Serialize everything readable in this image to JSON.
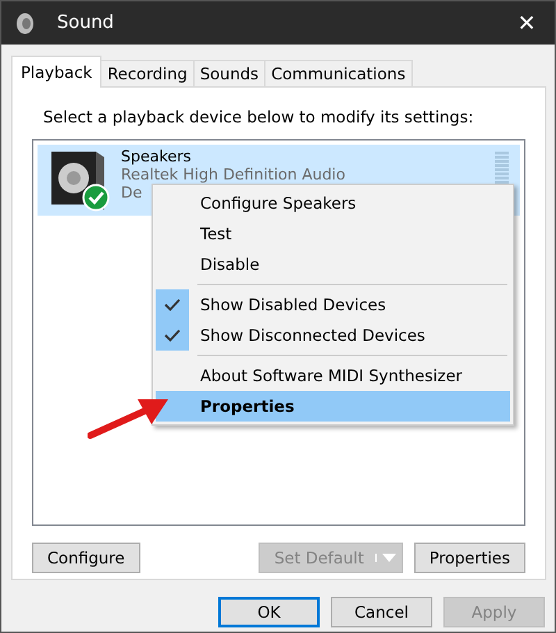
{
  "window": {
    "title": "Sound",
    "close": "✕"
  },
  "tabs": [
    {
      "label": "Playback",
      "selected": true
    },
    {
      "label": "Recording",
      "selected": false
    },
    {
      "label": "Sounds",
      "selected": false
    },
    {
      "label": "Communications",
      "selected": false
    }
  ],
  "instruction": "Select a playback device below to modify its settings:",
  "devices": [
    {
      "name": "Speakers",
      "driver": "Realtek High Definition Audio",
      "status": "De",
      "selected": true,
      "is_default": true
    }
  ],
  "context_menu": [
    {
      "kind": "item",
      "label": "Configure Speakers",
      "checked": false,
      "selected": false,
      "bold": false
    },
    {
      "kind": "item",
      "label": "Test",
      "checked": false,
      "selected": false,
      "bold": false
    },
    {
      "kind": "item",
      "label": "Disable",
      "checked": false,
      "selected": false,
      "bold": false
    },
    {
      "kind": "separator"
    },
    {
      "kind": "item",
      "label": "Show Disabled Devices",
      "checked": true,
      "selected": false,
      "bold": false
    },
    {
      "kind": "item",
      "label": "Show Disconnected Devices",
      "checked": true,
      "selected": false,
      "bold": false
    },
    {
      "kind": "separator"
    },
    {
      "kind": "item",
      "label": "About Software MIDI Synthesizer",
      "checked": false,
      "selected": false,
      "bold": false
    },
    {
      "kind": "item",
      "label": "Properties",
      "checked": false,
      "selected": true,
      "bold": true
    }
  ],
  "panel_buttons": [
    {
      "kind": "button",
      "label": "Configure",
      "disabled": false
    },
    {
      "kind": "split",
      "label": "Set Default",
      "disabled": true
    },
    {
      "kind": "button",
      "label": "Properties",
      "disabled": false
    }
  ],
  "dialog_buttons": [
    {
      "label": "OK",
      "disabled": false,
      "default": true
    },
    {
      "label": "Cancel",
      "disabled": false,
      "default": false
    },
    {
      "label": "Apply",
      "disabled": true,
      "default": false
    }
  ]
}
